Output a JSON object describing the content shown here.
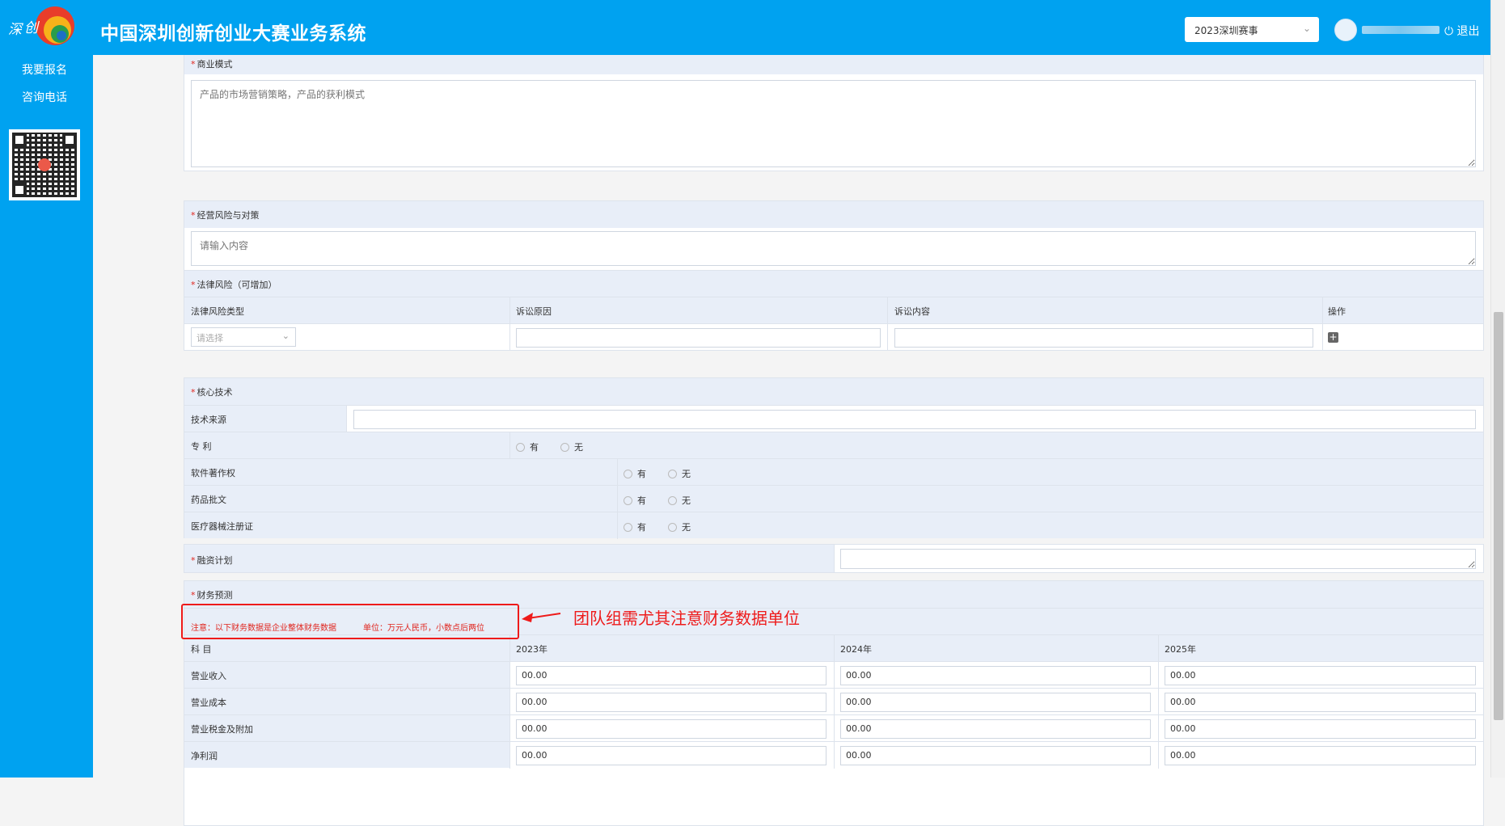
{
  "header": {
    "title": "中国深圳创新创业大赛业务系统",
    "season_select": "2023深圳赛事",
    "logout": "退出"
  },
  "sidebar": {
    "links": [
      "我要报名",
      "咨询电话"
    ]
  },
  "business_model": {
    "label": "商业模式",
    "placeholder": "产品的市场营销策略，产品的获利模式"
  },
  "risks": {
    "label": "经营风险与对策",
    "placeholder": "请输入内容",
    "legal_label": "法律风险（可增加）",
    "columns": [
      "法律风险类型",
      "诉讼原因",
      "诉讼内容",
      "操作"
    ],
    "type_placeholder": "请选择"
  },
  "tech": {
    "label": "核心技术",
    "source_label": "技术来源",
    "rows": [
      {
        "label": "专 利",
        "yes": "有",
        "no": "无"
      },
      {
        "label": "软件著作权",
        "yes": "有",
        "no": "无"
      },
      {
        "label": "药品批文",
        "yes": "有",
        "no": "无"
      },
      {
        "label": "医疗器械注册证",
        "yes": "有",
        "no": "无"
      }
    ]
  },
  "financing": {
    "label": "融资计划"
  },
  "finance": {
    "label": "财务预测",
    "note1": "注意：以下财务数据是企业整体财务数据",
    "note2": "单位：万元人民币，小数点后两位",
    "annotation": "团队组需尤其注意财务数据单位",
    "columns": [
      "科 目",
      "2023年",
      "2024年",
      "2025年"
    ],
    "rows": [
      {
        "label": "营业收入",
        "values": [
          "00.00",
          "00.00",
          "00.00"
        ]
      },
      {
        "label": "营业成本",
        "values": [
          "00.00",
          "00.00",
          "00.00"
        ]
      },
      {
        "label": "营业税金及附加",
        "values": [
          "00.00",
          "00.00",
          "00.00"
        ]
      },
      {
        "label": "净利润",
        "values": [
          "00.00",
          "00.00",
          "00.00"
        ]
      }
    ]
  },
  "colors": {
    "brand": "#00a2f0",
    "header_row": "#e8eef8",
    "required": "#e0251e",
    "annotation": "#ee1a1a"
  }
}
